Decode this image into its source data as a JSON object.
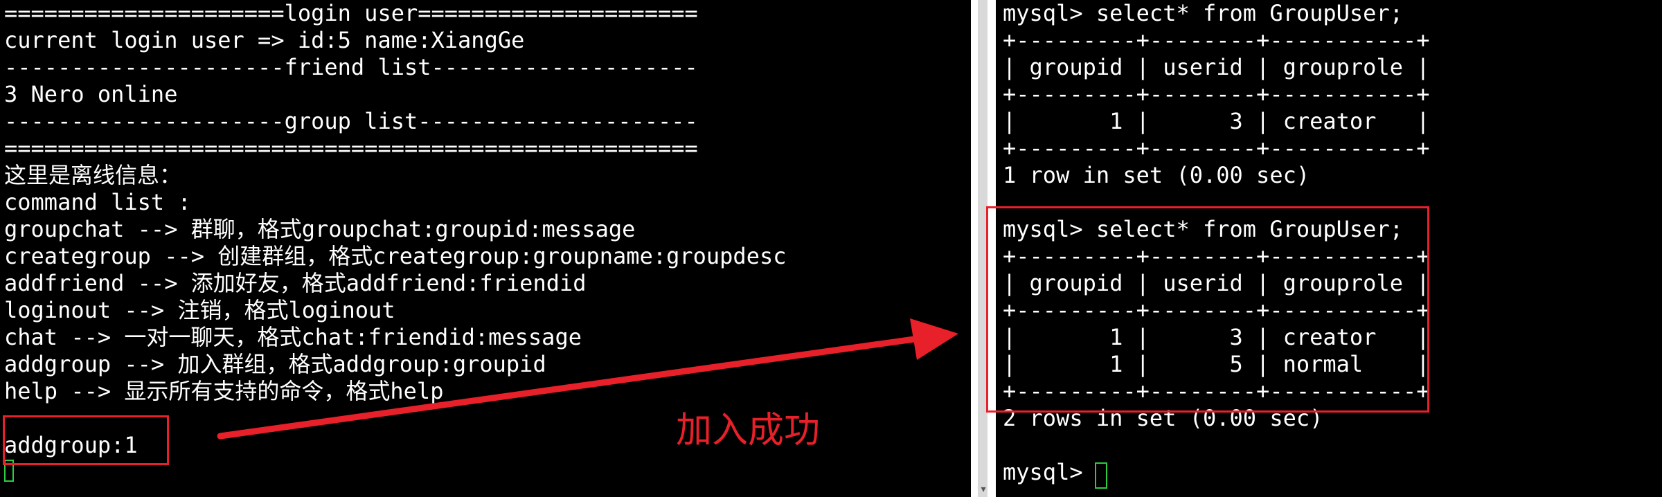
{
  "left_terminal": {
    "lines": [
      "=====================login user=====================",
      "current login user => id:5 name:XiangGe",
      "---------------------friend list--------------------",
      "3 Nero online",
      "---------------------group list---------------------",
      "====================================================",
      "这里是离线信息：",
      "command list :",
      "groupchat --> 群聊，格式groupchat:groupid:message",
      "creategroup --> 创建群组，格式creategroup:groupname:groupdesc",
      "addfriend --> 添加好友，格式addfriend:friendid",
      "loginout --> 注销，格式loginout",
      "chat --> 一对一聊天，格式chat:friendid:message",
      "addgroup --> 加入群组，格式addgroup:groupid",
      "help --> 显示所有支持的命令，格式help",
      "",
      "addgroup:1"
    ]
  },
  "right_terminal": {
    "lines": [
      "mysql> select* from GroupUser;",
      "+---------+--------+-----------+",
      "| groupid | userid | grouprole |",
      "+---------+--------+-----------+",
      "|       1 |      3 | creator   |",
      "+---------+--------+-----------+",
      "1 row in set (0.00 sec)",
      "",
      "mysql> select* from GroupUser;",
      "+---------+--------+-----------+",
      "| groupid | userid | grouprole |",
      "+---------+--------+-----------+",
      "|       1 |      3 | creator   |",
      "|       1 |      5 | normal    |",
      "+---------+--------+-----------+",
      "2 rows in set (0.00 sec)",
      "",
      "mysql> "
    ]
  },
  "annotation": {
    "label": "加入成功",
    "color": "#e8202a"
  },
  "colors": {
    "terminal_bg": "#000000",
    "terminal_fg": "#ffffff",
    "cursor": "#2ecc40"
  }
}
